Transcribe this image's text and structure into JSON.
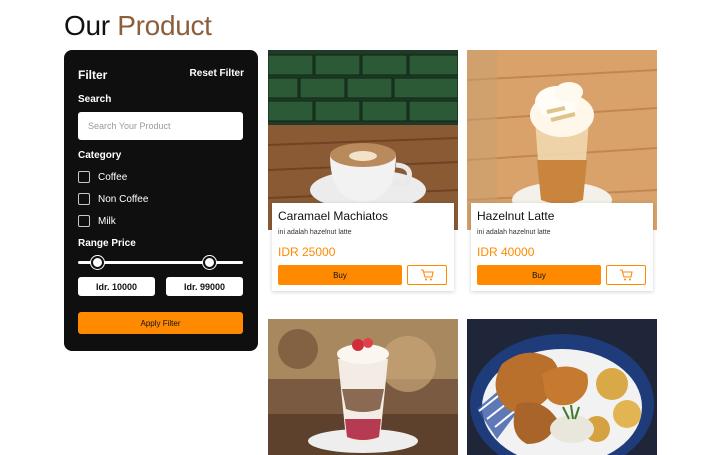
{
  "header": {
    "title_prefix": "Our",
    "title_accent": "Product"
  },
  "filter": {
    "title": "Filter",
    "reset_label": "Reset Filter",
    "search_label": "Search",
    "search_placeholder": "Search Your Product",
    "category_label": "Category",
    "categories": [
      {
        "label": "Coffee",
        "checked": false
      },
      {
        "label": "Non Coffee",
        "checked": false
      },
      {
        "label": "Milk",
        "checked": false
      }
    ],
    "range_label": "Range Price",
    "min_price": "Idr. 10000",
    "max_price": "Idr. 99000",
    "apply_label": "Apply Filter"
  },
  "products": [
    {
      "name": "Caramael Machiatos",
      "description": "ini adalah hazelnut latte",
      "price": "IDR 25000",
      "buy_label": "Buy",
      "image": "coffee-cup-photo"
    },
    {
      "name": "Hazelnut Latte",
      "description": "ini adalah hazelnut latte",
      "price": "IDR 40000",
      "buy_label": "Buy",
      "image": "iced-latte-photo"
    },
    {
      "name": "",
      "description": "",
      "price": "",
      "buy_label": "",
      "image": "parfait-dessert-photo"
    },
    {
      "name": "",
      "description": "",
      "price": "",
      "buy_label": "",
      "image": "fried-chicken-photo"
    }
  ],
  "colors": {
    "accent": "#ff8a00",
    "title_accent": "#8b5e3c",
    "panel": "#0f0f0f"
  },
  "icons": {
    "cart": "cart-icon"
  }
}
